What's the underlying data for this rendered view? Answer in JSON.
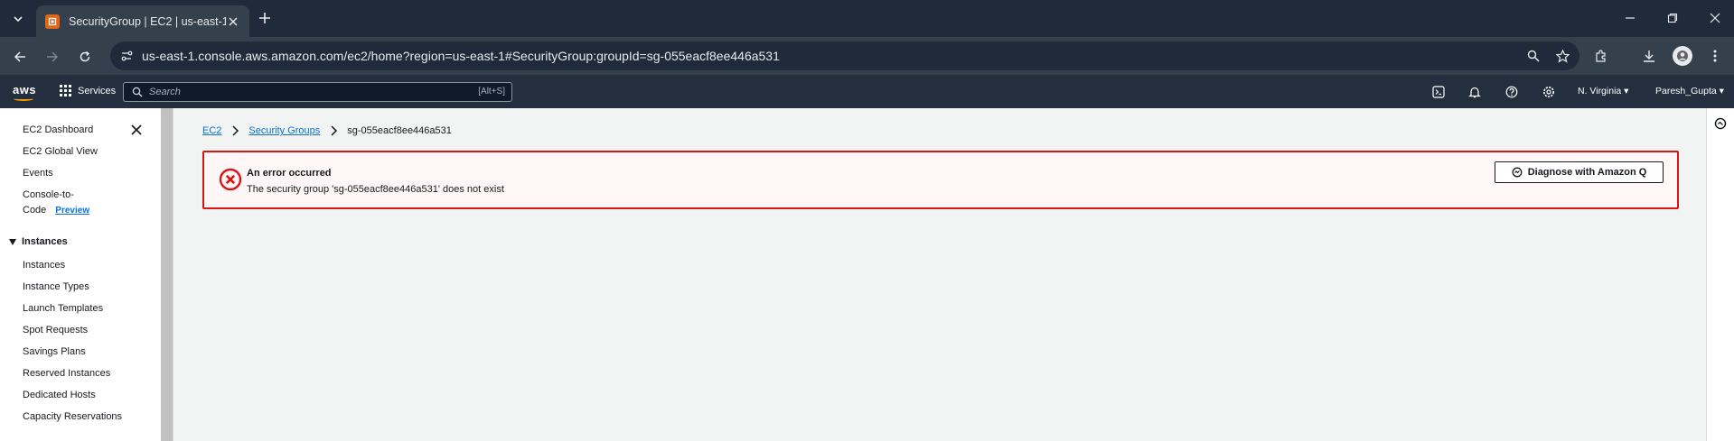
{
  "browser": {
    "tab_title": "SecurityGroup | EC2 | us-east-1",
    "url": "us-east-1.console.aws.amazon.com/ec2/home?region=us-east-1#SecurityGroup:groupId=sg-055eacf8ee446a531"
  },
  "aws_nav": {
    "logo": "aws",
    "services_label": "Services",
    "search_placeholder": "Search",
    "search_shortcut": "[Alt+S]",
    "region": "N. Virginia ▾",
    "user": "Paresh_Gupta ▾",
    "accent_color": "#ff9900"
  },
  "sidebar": {
    "items_top": [
      {
        "label": "EC2 Dashboard"
      },
      {
        "label": "EC2 Global View"
      },
      {
        "label": "Events"
      }
    ],
    "console_to_code": {
      "line1": "Console-to-",
      "line2": "Code",
      "badge": "Preview"
    },
    "section_title": "Instances",
    "section_items": [
      {
        "label": "Instances"
      },
      {
        "label": "Instance Types"
      },
      {
        "label": "Launch Templates"
      },
      {
        "label": "Spot Requests"
      },
      {
        "label": "Savings Plans"
      },
      {
        "label": "Reserved Instances"
      },
      {
        "label": "Dedicated Hosts"
      },
      {
        "label": "Capacity Reservations"
      }
    ]
  },
  "breadcrumb": {
    "items": [
      "EC2",
      "Security Groups"
    ],
    "current": "sg-055eacf8ee446a531"
  },
  "alert": {
    "title": "An error occurred",
    "message": "The security group 'sg-055eacf8ee446a531' does not exist",
    "button_label": "Diagnose with Amazon Q",
    "status_color": "#d91515"
  }
}
